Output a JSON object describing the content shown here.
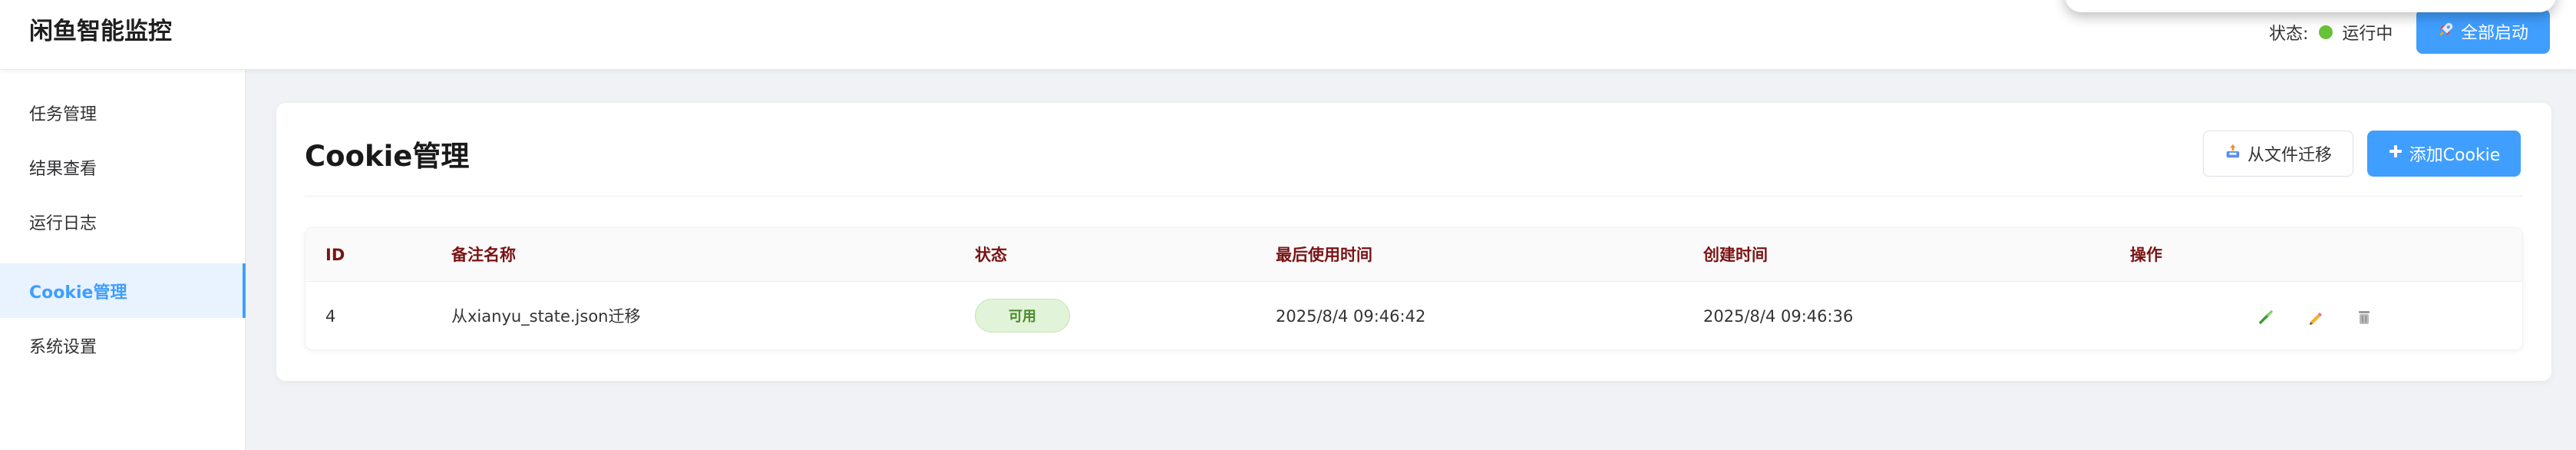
{
  "header": {
    "app_title": "闲鱼智能监控",
    "status_label": "状态:",
    "status_text": "运行中",
    "status_color": "#67c23a",
    "start_all_icon": "rocket-icon",
    "start_all_label": "全部启动"
  },
  "sidebar": {
    "items": [
      {
        "label": "任务管理",
        "active": false
      },
      {
        "label": "结果查看",
        "active": false
      },
      {
        "label": "运行日志",
        "active": false
      },
      {
        "label": "Cookie管理",
        "active": true
      },
      {
        "label": "系统设置",
        "active": false
      }
    ]
  },
  "main": {
    "title": "Cookie管理",
    "migrate_icon": "inbox-upload-icon",
    "migrate_label": "从文件迁移",
    "add_icon": "plus-icon",
    "add_label": "添加Cookie",
    "accent_color": "#409eff",
    "table": {
      "columns": [
        "ID",
        "备注名称",
        "状态",
        "最后使用时间",
        "创建时间",
        "操作"
      ],
      "rows": [
        {
          "id": "4",
          "name": "从xianyu_state.json迁移",
          "status": "可用",
          "last_used": "2025/8/4 09:46:42",
          "created": "2025/8/4 09:46:36",
          "actions": [
            "test-icon",
            "edit-icon",
            "delete-icon"
          ]
        }
      ]
    }
  }
}
